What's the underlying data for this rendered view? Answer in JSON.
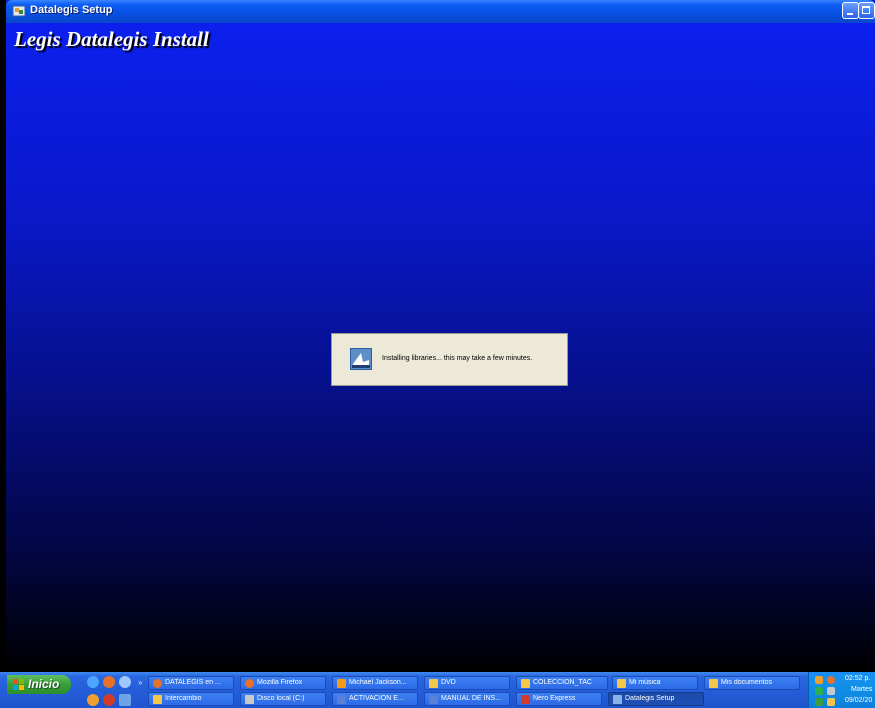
{
  "window": {
    "title": "Datalegis Setup",
    "heading": "Legis Datalegis Install"
  },
  "dialog": {
    "message": "Installing libraries... this may take a few minutes."
  },
  "taskbar": {
    "start_label": "Inicio",
    "overflow_chevron": "»",
    "buttons_row1": [
      {
        "label": "DATALEGIS en ...",
        "icon": "firefox-icon",
        "color": "#e8722a"
      },
      {
        "label": "Mozilla Firefox",
        "icon": "firefox-icon",
        "color": "#e8722a"
      },
      {
        "label": "Michael Jackson...",
        "icon": "vlc-icon",
        "color": "#f59a1b"
      },
      {
        "label": "DVD",
        "icon": "folder-icon",
        "color": "#f3c84a"
      },
      {
        "label": "COLECCION_TAC",
        "icon": "folder-icon",
        "color": "#f3c84a"
      },
      {
        "label": "Mi música",
        "icon": "folder-icon",
        "color": "#f3c84a"
      },
      {
        "label": "Mis documentos",
        "icon": "documents-icon",
        "color": "#f3c84a"
      }
    ],
    "buttons_row2": [
      {
        "label": "Intercambio",
        "icon": "folder-icon",
        "color": "#f3c84a"
      },
      {
        "label": "Disco local (C:)",
        "icon": "drive-icon",
        "color": "#c9c9c9"
      },
      {
        "label": "ACTIVACION E...",
        "icon": "word-icon",
        "color": "#5a7fd6"
      },
      {
        "label": "MANUAL DE INS...",
        "icon": "word-icon",
        "color": "#5a7fd6"
      },
      {
        "label": "Nero Express",
        "icon": "nero-icon",
        "color": "#d23a2a"
      },
      {
        "label": "Datalegis Setup",
        "icon": "setup-icon",
        "color": "#8ab4e8"
      }
    ],
    "clock": {
      "time": "02:52 p.",
      "day": "Martes",
      "date": "09/02/20"
    }
  }
}
